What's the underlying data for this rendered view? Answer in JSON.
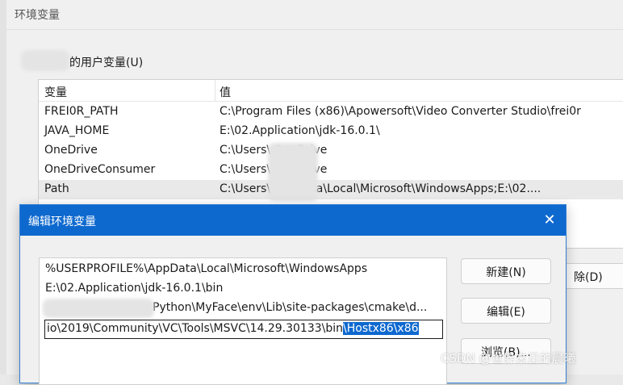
{
  "window": {
    "title": "环境变量"
  },
  "user_vars": {
    "group_label": "的用户变量(U)",
    "headers": {
      "name": "变量",
      "value": "值"
    },
    "rows": [
      {
        "name": "FREI0R_PATH",
        "value": "C:\\Program Files (x86)\\Apowersoft\\Video Converter Studio\\frei0r"
      },
      {
        "name": "JAVA_HOME",
        "value": "E:\\02.Application\\jdk-16.0.1\\"
      },
      {
        "name": "OneDrive",
        "value": "C:\\Users\\        OneDrive"
      },
      {
        "name": "OneDriveConsumer",
        "value": "C:\\Users\\        OneDrive"
      },
      {
        "name": "Path",
        "value": "C:\\Users\\        AppData\\Local\\Microsoft\\WindowsApps;E:\\02...."
      }
    ],
    "delete_label": "除(D)"
  },
  "dialog": {
    "title": "编辑环境变量",
    "paths": [
      "%USERPROFILE%\\AppData\\Local\\Microsoft\\WindowsApps",
      "E:\\02.Application\\jdk-16.0.1\\bin",
      "Python\\MyFace\\env\\Lib\\site-packages\\cmake\\d..."
    ],
    "editing": {
      "plain": "io\\2019\\Community\\VC\\Tools\\MSVC\\14.29.30133\\bin",
      "selected": "\\Hostx86\\x86"
    },
    "buttons": {
      "new": "新建(N)",
      "edit": "编辑(E)",
      "browse": "浏览(B)..."
    }
  },
  "watermark": "CSDN @世界末日的晨曦",
  "colors": {
    "dialog_title_bg": "#0e69cf",
    "selection": "#0e69cf"
  }
}
